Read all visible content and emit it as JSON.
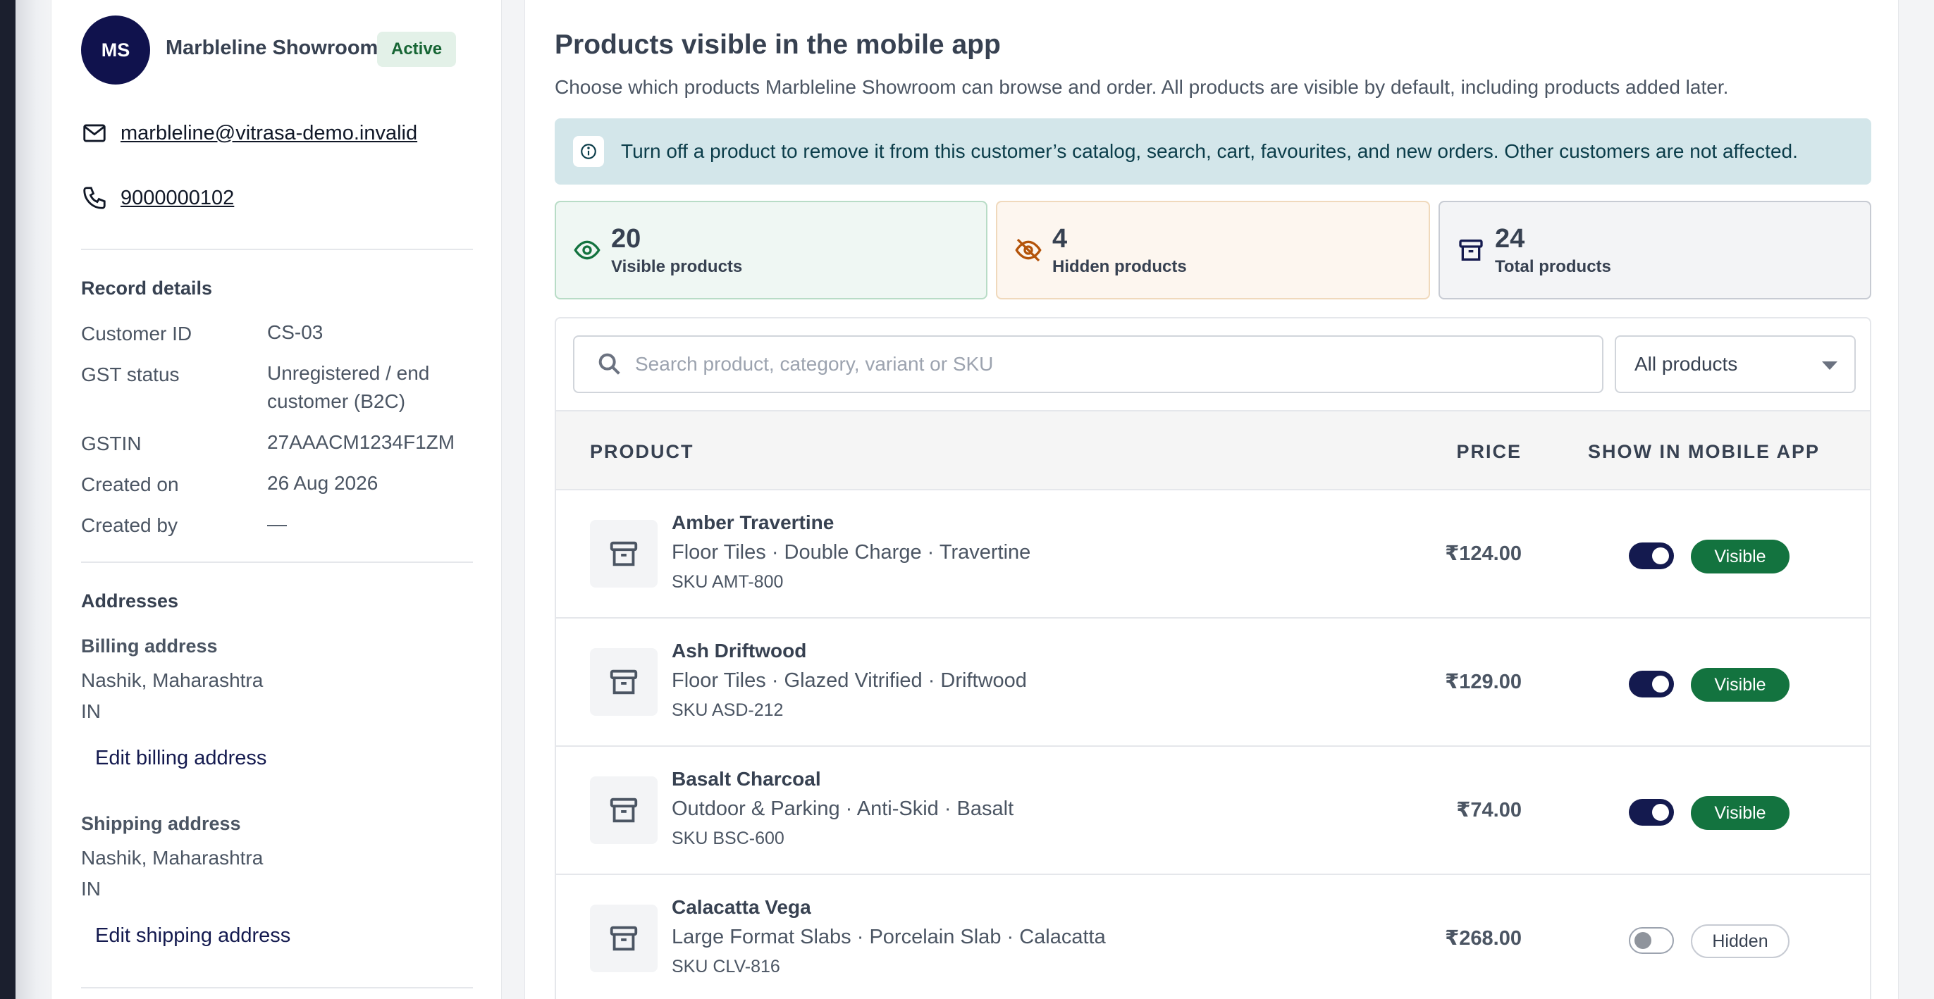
{
  "customer": {
    "initials": "MS",
    "name": "Marbleline Showroom",
    "status": "Active",
    "email": "marbleline@vitrasa-demo.invalid",
    "phone": "9000000102"
  },
  "record_details": {
    "title": "Record details",
    "rows": [
      {
        "label": "Customer ID",
        "value": "CS-03"
      },
      {
        "label": "GST status",
        "value": "Unregistered / end customer (B2C)"
      },
      {
        "label": "GSTIN",
        "value": "27AAACM1234F1ZM"
      },
      {
        "label": "Created on",
        "value": "26 Aug 2026"
      },
      {
        "label": "Created by",
        "value": "—"
      }
    ]
  },
  "addresses": {
    "title": "Addresses",
    "billing": {
      "title": "Billing address",
      "line1": "Nashik, Maharashtra",
      "line2": "IN",
      "edit_label": "Edit billing address"
    },
    "shipping": {
      "title": "Shipping address",
      "line1": "Nashik, Maharashtra",
      "line2": "IN",
      "edit_label": "Edit shipping address"
    }
  },
  "main": {
    "title": "Products visible in the mobile app",
    "subtitle": "Choose which products Marbleline Showroom can browse and order. All products are visible by default, including products added later.",
    "banner": "Turn off a product to remove it from this customer’s catalog, search, cart, favourites, and new orders. Other customers are not affected."
  },
  "stats": {
    "visible": {
      "count": "20",
      "label": "Visible products"
    },
    "hidden": {
      "count": "4",
      "label": "Hidden products"
    },
    "total": {
      "count": "24",
      "label": "Total products"
    }
  },
  "filters": {
    "search_placeholder": "Search product, category, variant or SKU",
    "select_value": "All products"
  },
  "table": {
    "headers": {
      "product": "PRODUCT",
      "price": "PRICE",
      "show": "SHOW IN MOBILE APP"
    },
    "rows": [
      {
        "name": "Amber Travertine",
        "category": "Floor Tiles · Double Charge · Travertine",
        "sku": "SKU AMT-800",
        "price": "₹124.00",
        "enabled": true,
        "status": "Visible"
      },
      {
        "name": "Ash Driftwood",
        "category": "Floor Tiles · Glazed Vitrified · Driftwood",
        "sku": "SKU ASD-212",
        "price": "₹129.00",
        "enabled": true,
        "status": "Visible"
      },
      {
        "name": "Basalt Charcoal",
        "category": "Outdoor & Parking · Anti-Skid · Basalt",
        "sku": "SKU BSC-600",
        "price": "₹74.00",
        "enabled": true,
        "status": "Visible"
      },
      {
        "name": "Calacatta Vega",
        "category": "Large Format Slabs · Porcelain Slab · Calacatta",
        "sku": "SKU CLV-816",
        "price": "₹268.00",
        "enabled": false,
        "status": "Hidden"
      }
    ]
  },
  "colors": {
    "brand_navy": "#141a4f",
    "visible_green": "#13733f",
    "banner_bg": "#d3e6ea"
  },
  "icons": [
    "mail-icon",
    "phone-icon",
    "info-icon",
    "eye-icon",
    "eye-off-icon",
    "archive-icon",
    "search-icon",
    "chevron-down-icon"
  ]
}
